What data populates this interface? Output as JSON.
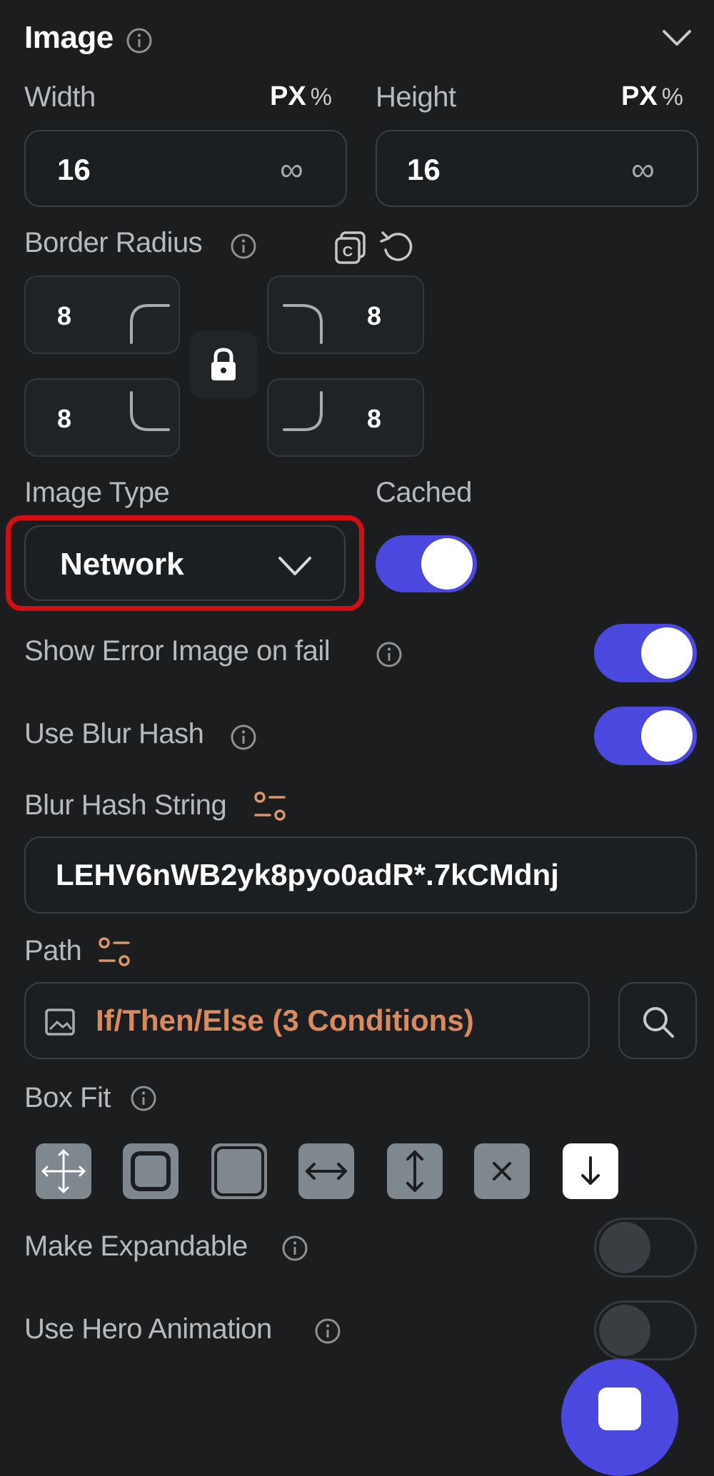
{
  "section": {
    "title": "Image"
  },
  "width": {
    "label": "Width",
    "unit_px": "PX",
    "unit_pct": "%",
    "value": "16",
    "infinity": "∞"
  },
  "height": {
    "label": "Height",
    "unit_px": "PX",
    "unit_pct": "%",
    "value": "16",
    "infinity": "∞"
  },
  "border_radius": {
    "label": "Border Radius",
    "top_left": "8",
    "top_right": "8",
    "bottom_left": "8",
    "bottom_right": "8"
  },
  "image_type": {
    "label": "Image Type",
    "value": "Network"
  },
  "cached": {
    "label": "Cached",
    "on": true
  },
  "show_error_image": {
    "label": "Show Error Image on fail",
    "on": true
  },
  "use_blur_hash": {
    "label": "Use Blur Hash",
    "on": true
  },
  "blur_hash_string": {
    "label": "Blur Hash String",
    "value": "LEHV6nWB2yk8pyo0adR*.7kCMdnj"
  },
  "path": {
    "label": "Path",
    "value": "If/Then/Else (3 Conditions)",
    "value_color": "#d98a5e"
  },
  "box_fit": {
    "label": "Box Fit",
    "options": [
      "expand-icon",
      "rounded-square-icon",
      "filled-square-icon",
      "horizontal-arrows-icon",
      "vertical-arrows-icon",
      "close-icon",
      "arrow-down-icon"
    ],
    "selected": "arrow-down-icon"
  },
  "make_expandable": {
    "label": "Make Expandable",
    "on": false
  },
  "use_hero_animation": {
    "label": "Use Hero Animation",
    "on": false
  },
  "colors": {
    "accent": "#4b48e0",
    "highlight_border": "#d40f14",
    "background": "#1b1d1f"
  }
}
